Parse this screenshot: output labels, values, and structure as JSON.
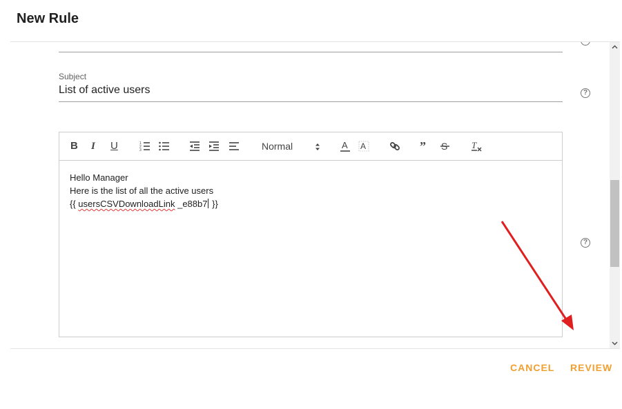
{
  "dialog": {
    "title": "New Rule"
  },
  "form": {
    "subject": {
      "label": "Subject",
      "value": "List of active users"
    },
    "editor": {
      "toolbar": {
        "header_select": "Normal",
        "buttons": [
          "bold",
          "italic",
          "underline",
          "ordered-list",
          "bullet-list",
          "outdent",
          "indent",
          "align",
          "header-select",
          "font-color",
          "background-color",
          "link",
          "blockquote",
          "strike",
          "clean"
        ]
      },
      "body": {
        "line1": "Hello Manager",
        "line2": "Here is the list of all the active users",
        "line3_prefix": "{{ ",
        "line3_link": "usersCSVDownloadLink",
        "line3_suffix_a": " _e88b7",
        "line3_suffix_b": " }}"
      }
    },
    "help_icon": "?"
  },
  "footer": {
    "cancel_label": "CANCEL",
    "review_label": "REVIEW"
  },
  "colors": {
    "accent": "#f0a030",
    "annotation_arrow": "#e02020"
  },
  "annotation": {
    "type": "arrow",
    "points_to": "review-button"
  }
}
